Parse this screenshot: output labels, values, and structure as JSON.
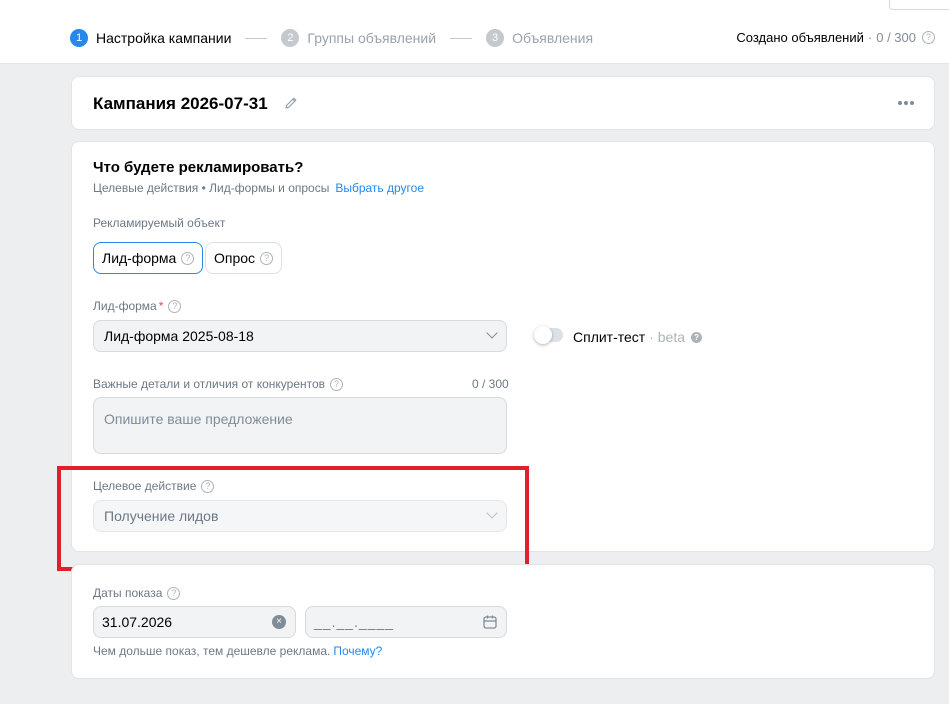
{
  "steps": [
    {
      "num": "1",
      "label": "Настройка кампании"
    },
    {
      "num": "2",
      "label": "Группы объявлений"
    },
    {
      "num": "3",
      "label": "Объявления"
    }
  ],
  "created": {
    "label": "Создано объявлений",
    "separator": "·",
    "count": "0 / 300"
  },
  "campaign": {
    "title": "Кампания 2026-07-31"
  },
  "objective": {
    "title": "Что будете рекламировать?",
    "subtitle": "Целевые действия • Лид-формы и опросы",
    "change_link": "Выбрать другое"
  },
  "advertised_object": {
    "label": "Рекламируемый объект",
    "options": [
      "Лид-форма",
      "Опрос"
    ],
    "selected": "Лид-форма"
  },
  "lead_form": {
    "label": "Лид-форма",
    "required_mark": "*",
    "value": "Лид-форма 2025-08-18"
  },
  "split_test": {
    "label": "Сплит-тест",
    "beta": "· beta",
    "enabled": false
  },
  "details": {
    "label": "Важные детали и отличия от конкурентов",
    "counter": "0 / 300",
    "placeholder": "Опишите ваше предложение"
  },
  "target_action": {
    "label": "Целевое действие",
    "value": "Получение лидов"
  },
  "dates": {
    "label": "Даты показа",
    "start": "31.07.2026",
    "end_placeholder": "__.__.____",
    "hint": "Чем дольше показ, тем дешевле реклама.",
    "hint_link": "Почему?"
  },
  "colors": {
    "accent": "#2688eb",
    "highlight": "#e0212b",
    "background": "#edeef0"
  }
}
